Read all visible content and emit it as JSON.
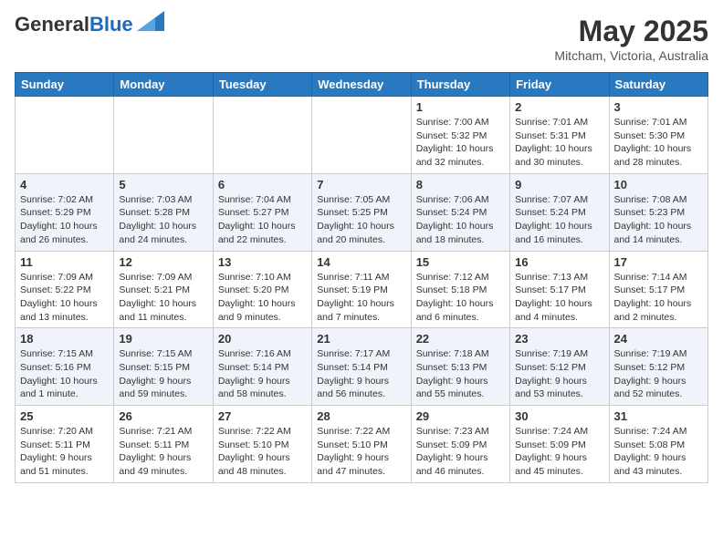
{
  "logo": {
    "line1": "General",
    "line2": "Blue"
  },
  "title": "May 2025",
  "subtitle": "Mitcham, Victoria, Australia",
  "days_of_week": [
    "Sunday",
    "Monday",
    "Tuesday",
    "Wednesday",
    "Thursday",
    "Friday",
    "Saturday"
  ],
  "weeks": [
    [
      {
        "day": "",
        "info": ""
      },
      {
        "day": "",
        "info": ""
      },
      {
        "day": "",
        "info": ""
      },
      {
        "day": "",
        "info": ""
      },
      {
        "day": "1",
        "info": "Sunrise: 7:00 AM\nSunset: 5:32 PM\nDaylight: 10 hours\nand 32 minutes."
      },
      {
        "day": "2",
        "info": "Sunrise: 7:01 AM\nSunset: 5:31 PM\nDaylight: 10 hours\nand 30 minutes."
      },
      {
        "day": "3",
        "info": "Sunrise: 7:01 AM\nSunset: 5:30 PM\nDaylight: 10 hours\nand 28 minutes."
      }
    ],
    [
      {
        "day": "4",
        "info": "Sunrise: 7:02 AM\nSunset: 5:29 PM\nDaylight: 10 hours\nand 26 minutes."
      },
      {
        "day": "5",
        "info": "Sunrise: 7:03 AM\nSunset: 5:28 PM\nDaylight: 10 hours\nand 24 minutes."
      },
      {
        "day": "6",
        "info": "Sunrise: 7:04 AM\nSunset: 5:27 PM\nDaylight: 10 hours\nand 22 minutes."
      },
      {
        "day": "7",
        "info": "Sunrise: 7:05 AM\nSunset: 5:25 PM\nDaylight: 10 hours\nand 20 minutes."
      },
      {
        "day": "8",
        "info": "Sunrise: 7:06 AM\nSunset: 5:24 PM\nDaylight: 10 hours\nand 18 minutes."
      },
      {
        "day": "9",
        "info": "Sunrise: 7:07 AM\nSunset: 5:24 PM\nDaylight: 10 hours\nand 16 minutes."
      },
      {
        "day": "10",
        "info": "Sunrise: 7:08 AM\nSunset: 5:23 PM\nDaylight: 10 hours\nand 14 minutes."
      }
    ],
    [
      {
        "day": "11",
        "info": "Sunrise: 7:09 AM\nSunset: 5:22 PM\nDaylight: 10 hours\nand 13 minutes."
      },
      {
        "day": "12",
        "info": "Sunrise: 7:09 AM\nSunset: 5:21 PM\nDaylight: 10 hours\nand 11 minutes."
      },
      {
        "day": "13",
        "info": "Sunrise: 7:10 AM\nSunset: 5:20 PM\nDaylight: 10 hours\nand 9 minutes."
      },
      {
        "day": "14",
        "info": "Sunrise: 7:11 AM\nSunset: 5:19 PM\nDaylight: 10 hours\nand 7 minutes."
      },
      {
        "day": "15",
        "info": "Sunrise: 7:12 AM\nSunset: 5:18 PM\nDaylight: 10 hours\nand 6 minutes."
      },
      {
        "day": "16",
        "info": "Sunrise: 7:13 AM\nSunset: 5:17 PM\nDaylight: 10 hours\nand 4 minutes."
      },
      {
        "day": "17",
        "info": "Sunrise: 7:14 AM\nSunset: 5:17 PM\nDaylight: 10 hours\nand 2 minutes."
      }
    ],
    [
      {
        "day": "18",
        "info": "Sunrise: 7:15 AM\nSunset: 5:16 PM\nDaylight: 10 hours\nand 1 minute."
      },
      {
        "day": "19",
        "info": "Sunrise: 7:15 AM\nSunset: 5:15 PM\nDaylight: 9 hours\nand 59 minutes."
      },
      {
        "day": "20",
        "info": "Sunrise: 7:16 AM\nSunset: 5:14 PM\nDaylight: 9 hours\nand 58 minutes."
      },
      {
        "day": "21",
        "info": "Sunrise: 7:17 AM\nSunset: 5:14 PM\nDaylight: 9 hours\nand 56 minutes."
      },
      {
        "day": "22",
        "info": "Sunrise: 7:18 AM\nSunset: 5:13 PM\nDaylight: 9 hours\nand 55 minutes."
      },
      {
        "day": "23",
        "info": "Sunrise: 7:19 AM\nSunset: 5:12 PM\nDaylight: 9 hours\nand 53 minutes."
      },
      {
        "day": "24",
        "info": "Sunrise: 7:19 AM\nSunset: 5:12 PM\nDaylight: 9 hours\nand 52 minutes."
      }
    ],
    [
      {
        "day": "25",
        "info": "Sunrise: 7:20 AM\nSunset: 5:11 PM\nDaylight: 9 hours\nand 51 minutes."
      },
      {
        "day": "26",
        "info": "Sunrise: 7:21 AM\nSunset: 5:11 PM\nDaylight: 9 hours\nand 49 minutes."
      },
      {
        "day": "27",
        "info": "Sunrise: 7:22 AM\nSunset: 5:10 PM\nDaylight: 9 hours\nand 48 minutes."
      },
      {
        "day": "28",
        "info": "Sunrise: 7:22 AM\nSunset: 5:10 PM\nDaylight: 9 hours\nand 47 minutes."
      },
      {
        "day": "29",
        "info": "Sunrise: 7:23 AM\nSunset: 5:09 PM\nDaylight: 9 hours\nand 46 minutes."
      },
      {
        "day": "30",
        "info": "Sunrise: 7:24 AM\nSunset: 5:09 PM\nDaylight: 9 hours\nand 45 minutes."
      },
      {
        "day": "31",
        "info": "Sunrise: 7:24 AM\nSunset: 5:08 PM\nDaylight: 9 hours\nand 43 minutes."
      }
    ]
  ]
}
